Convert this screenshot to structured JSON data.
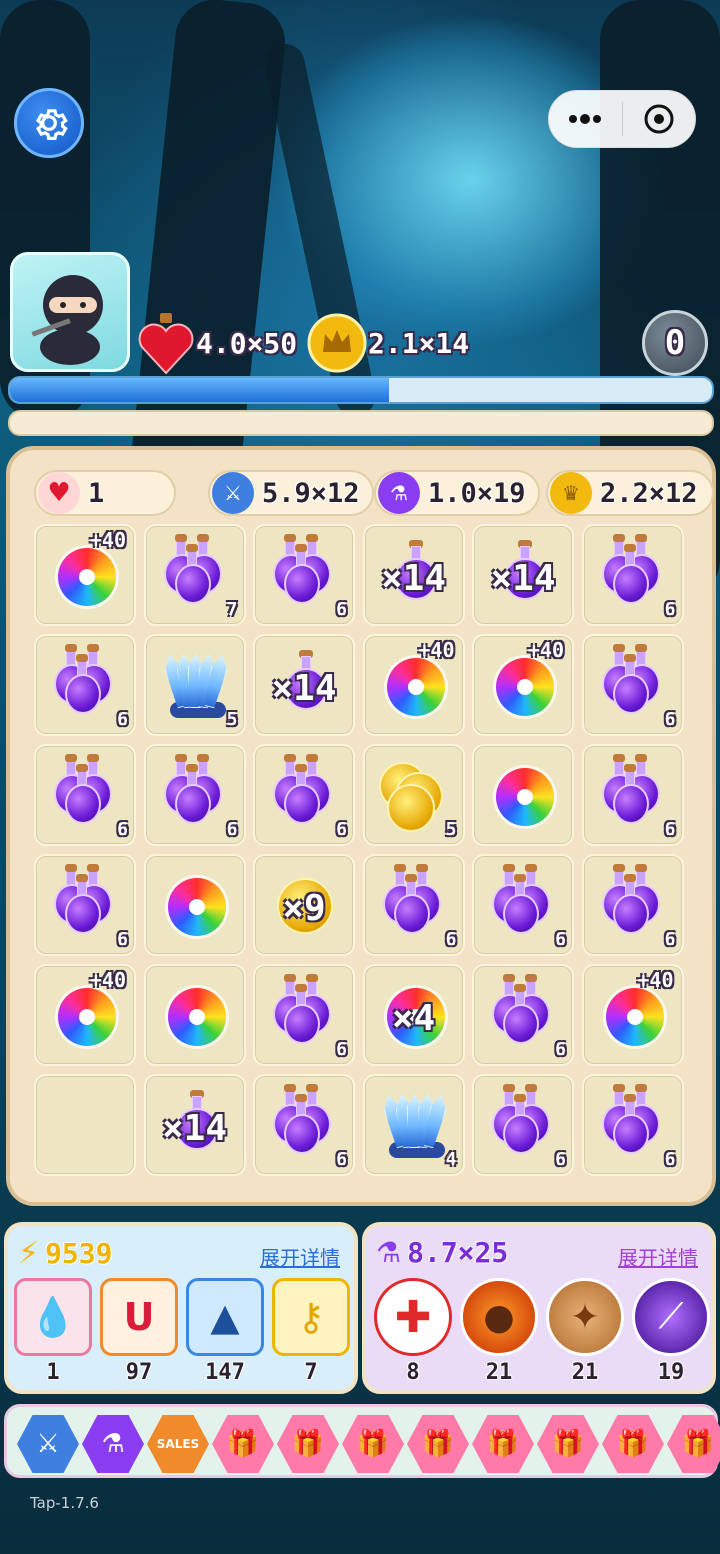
{
  "top": {
    "settings_icon": "gear-icon",
    "capsule_menu_icon": "more-dots-icon",
    "capsule_close_icon": "target-circle-icon"
  },
  "player": {
    "avatar": "ninja-avatar",
    "hearts_stat": "4.0×50",
    "coins_stat": "2.1×14",
    "zero_button": "0",
    "progress_fraction": 0.54
  },
  "resources": {
    "heart": "1",
    "sword": "5.9×12",
    "potion": "1.0×19",
    "coin": "2.2×12"
  },
  "grid": [
    [
      {
        "t": "rainbow",
        "bonus": "+40"
      },
      {
        "t": "potion",
        "n": "7"
      },
      {
        "t": "potion",
        "n": "6"
      },
      {
        "t": "potion_single",
        "mult": "×14"
      },
      {
        "t": "potion_single",
        "mult": "×14"
      },
      {
        "t": "potion",
        "n": "6"
      }
    ],
    [
      {
        "t": "potion",
        "n": "6"
      },
      {
        "t": "crystal",
        "n": "5"
      },
      {
        "t": "potion_single",
        "mult": "×14"
      },
      {
        "t": "rainbow",
        "bonus": "+40"
      },
      {
        "t": "rainbow",
        "bonus": "+40"
      },
      {
        "t": "potion",
        "n": "6"
      }
    ],
    [
      {
        "t": "potion",
        "n": "6"
      },
      {
        "t": "potion",
        "n": "6"
      },
      {
        "t": "potion",
        "n": "6"
      },
      {
        "t": "coins",
        "n": "5"
      },
      {
        "t": "rainbow"
      },
      {
        "t": "potion",
        "n": "6"
      }
    ],
    [
      {
        "t": "potion",
        "n": "6"
      },
      {
        "t": "rainbow"
      },
      {
        "t": "coin_single",
        "mult": "×9"
      },
      {
        "t": "potion",
        "n": "6"
      },
      {
        "t": "potion",
        "n": "6"
      },
      {
        "t": "potion",
        "n": "6"
      }
    ],
    [
      {
        "t": "rainbow",
        "bonus": "+40"
      },
      {
        "t": "rainbow"
      },
      {
        "t": "potion",
        "n": "6"
      },
      {
        "t": "rainbow",
        "mult": "×4"
      },
      {
        "t": "potion",
        "n": "6"
      },
      {
        "t": "rainbow",
        "bonus": "+40"
      }
    ],
    [
      {
        "t": "empty"
      },
      {
        "t": "potion_single",
        "mult": "×14"
      },
      {
        "t": "potion",
        "n": "6"
      },
      {
        "t": "crystal",
        "n": "4"
      },
      {
        "t": "potion",
        "n": "6"
      },
      {
        "t": "potion",
        "n": "6"
      }
    ]
  ],
  "left_panel": {
    "energy": "9539",
    "link": "展开详情",
    "items": [
      {
        "icon": "blood-drop-icon",
        "count": "1"
      },
      {
        "icon": "magnet-icon",
        "count": "97"
      },
      {
        "icon": "shark-icon",
        "count": "147"
      },
      {
        "icon": "key-icon",
        "count": "7"
      }
    ]
  },
  "right_panel": {
    "potion_stat": "8.7×25",
    "link": "展开详情",
    "items": [
      {
        "icon": "heal-cross-icon",
        "count": "8"
      },
      {
        "icon": "meteor-icon",
        "count": "21"
      },
      {
        "icon": "earth-crack-icon",
        "count": "21"
      },
      {
        "icon": "slash-icon",
        "count": "19"
      }
    ]
  },
  "hotbar": [
    "swords-icon",
    "potion-icon",
    "sales-tag-icon",
    "gift-icon",
    "gift-icon",
    "gift-icon",
    "gift-icon",
    "gift-icon",
    "gift-icon",
    "gift-icon",
    "gift-icon"
  ],
  "sales_label": "SALES",
  "version": "Tap-1.7.6"
}
